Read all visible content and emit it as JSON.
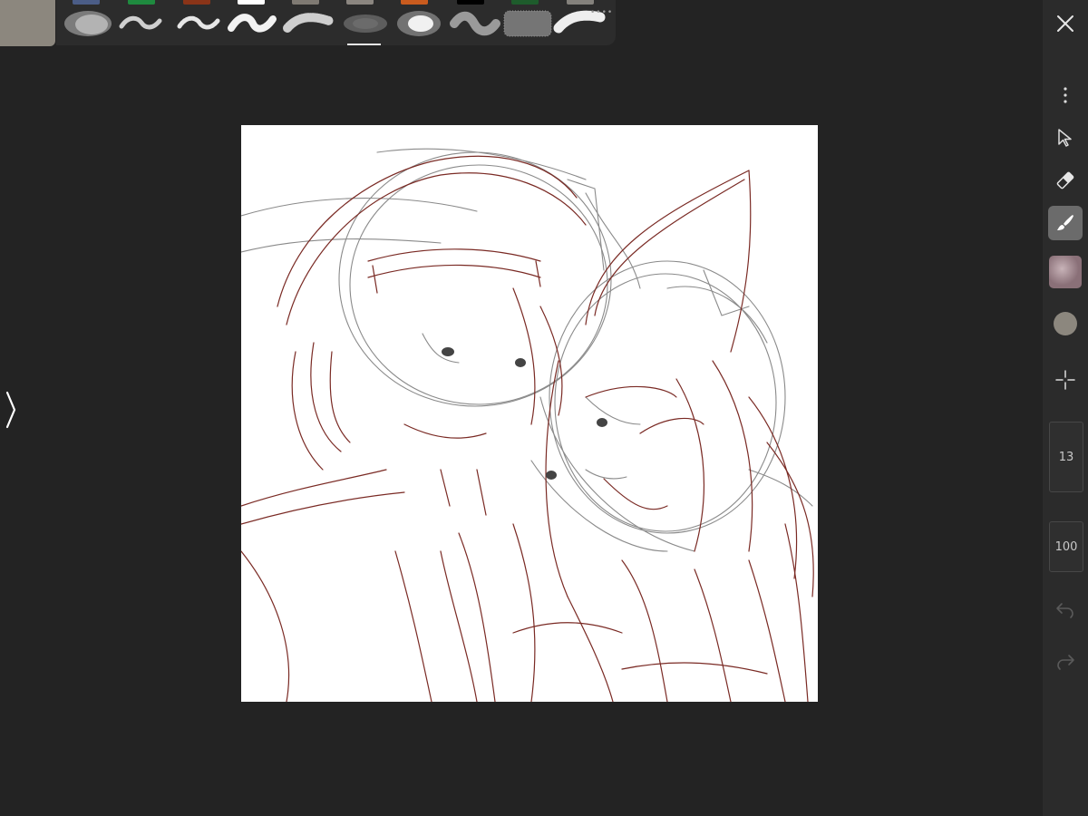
{
  "app": {
    "current_color": "#8c877e",
    "accent": "#6b6b6b"
  },
  "palette": {
    "swatches": [
      {
        "name": "slate-blue",
        "color": "#4b5d87"
      },
      {
        "name": "green",
        "color": "#1f8a3f"
      },
      {
        "name": "rust",
        "color": "#8a3418"
      },
      {
        "name": "white",
        "color": "#ffffff"
      },
      {
        "name": "warm-gray",
        "color": "#7f7a73"
      },
      {
        "name": "stone-gray",
        "color": "#8b8680"
      },
      {
        "name": "orange",
        "color": "#c95b1e"
      },
      {
        "name": "black",
        "color": "#000000"
      },
      {
        "name": "dark-green",
        "color": "#1e5c2c"
      },
      {
        "name": "gray",
        "color": "#84817c"
      }
    ]
  },
  "brushes": {
    "items": [
      {
        "name": "soft-airbrush",
        "selected": false
      },
      {
        "name": "thin-stroke",
        "selected": false
      },
      {
        "name": "textured-stroke",
        "selected": false
      },
      {
        "name": "solid-stroke",
        "selected": false
      },
      {
        "name": "spray",
        "selected": true
      },
      {
        "name": "blur",
        "selected": false
      },
      {
        "name": "soft-glow",
        "selected": false
      },
      {
        "name": "smudge",
        "selected": false
      },
      {
        "name": "splatter",
        "selected": false
      },
      {
        "name": "dry-brush",
        "selected": false
      }
    ],
    "page_dots": "••••"
  },
  "toolbar": {
    "close_icon": "close-icon",
    "more_icon": "more-vertical-icon",
    "select_icon": "pointer-icon",
    "eraser_icon": "eraser-icon",
    "brush_icon": "brush-icon",
    "layer_icon": "layer-thumbnail",
    "color_icon": "color-dot",
    "transform_icon": "crosshair-icon",
    "brush_size": "13",
    "opacity": "100",
    "undo_icon": "undo-icon",
    "redo_icon": "redo-icon"
  },
  "left_handle": {
    "icon": "chevron-right-icon"
  },
  "canvas": {
    "background": "#ffffff",
    "sketch_red": "#7a2a24",
    "sketch_gray": "#8a8a8a"
  }
}
